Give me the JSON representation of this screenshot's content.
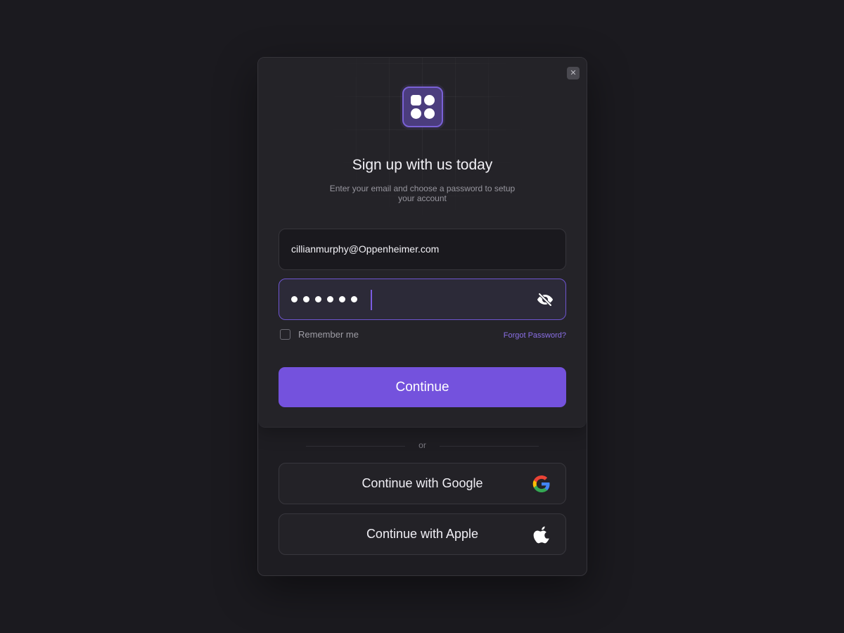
{
  "modal": {
    "close_icon": "close-icon",
    "logo_icon": "four-squares-logo-icon",
    "title": "Sign up with us today",
    "subtitle": "Enter your email and choose a password to setup your account",
    "email": {
      "value": "cillianmurphy@Oppenheimer.com"
    },
    "password": {
      "masked_length": 6,
      "toggle_icon": "eye-off-icon"
    },
    "remember_label": "Remember me",
    "remember_checked": false,
    "forgot_label": "Forgot Password?",
    "continue_label": "Continue",
    "divider_label": "or",
    "social": [
      {
        "label": "Continue with Google",
        "icon": "google-icon"
      },
      {
        "label": "Continue with Apple",
        "icon": "apple-icon"
      }
    ]
  },
  "colors": {
    "background": "#1b1a1f",
    "panel": "#242328",
    "accent": "#7452dd",
    "accent_border": "#6e55cf",
    "link": "#8a6fe6"
  }
}
